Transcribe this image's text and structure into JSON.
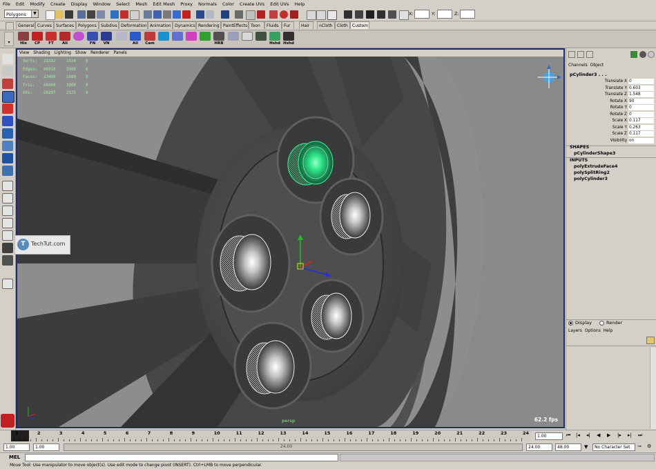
{
  "menubar": [
    "File",
    "Edit",
    "Modify",
    "Create",
    "Display",
    "Window",
    "Select",
    "Mesh",
    "Edit Mesh",
    "Proxy",
    "Normals",
    "Color",
    "Create UVs",
    "Edit UVs",
    "Help"
  ],
  "statusline": {
    "mode": "Polygons",
    "x_label": "X:",
    "y_label": "Y:",
    "z_label": "Z:"
  },
  "shelf_tabs": [
    "General",
    "Curves",
    "Surfaces",
    "Polygons",
    "Subdivs",
    "Deformation",
    "Animation",
    "Dynamics",
    "Rendering",
    "PaintEffects",
    "Toon",
    "Fluids",
    "Fur",
    "Hair",
    "nCloth",
    "Cloth",
    "Custom"
  ],
  "active_shelf_tab": "Custom",
  "shelf_buttons": [
    "His",
    "CP",
    "FT",
    "All",
    "",
    "FN",
    "VN",
    "",
    "",
    "All",
    "Cam",
    "",
    "",
    "",
    "",
    "HRB",
    "",
    "",
    "",
    "Hshd"
  ],
  "viewport": {
    "menu": [
      "View",
      "Shading",
      "Lighting",
      "Show",
      "Renderer",
      "Panels"
    ],
    "hud": [
      {
        "label": "Verts:",
        "total": "23332",
        "sel": "1510",
        "comp": "0"
      },
      {
        "label": "Edges:",
        "total": "46810",
        "sel": "3300",
        "comp": "0"
      },
      {
        "label": "Faces:",
        "total": "23480",
        "sel": "1800",
        "comp": "0"
      },
      {
        "label": "Tris:",
        "total": "46660",
        "sel": "3000",
        "comp": "0"
      },
      {
        "label": "UVs:",
        "total": "26297",
        "sel": "2135",
        "comp": "0"
      }
    ],
    "fps": "62.2 fps",
    "camera": "persp"
  },
  "watermark": {
    "brand": "TechTut",
    "suffix": ".com"
  },
  "channel_box": {
    "menu": [
      "Channels",
      "Object"
    ],
    "object": "pCylinder3 . . .",
    "attributes": [
      {
        "name": "Translate X",
        "value": "0"
      },
      {
        "name": "Translate Y",
        "value": "0.603"
      },
      {
        "name": "Translate Z",
        "value": "1.548"
      },
      {
        "name": "Rotate X",
        "value": "90"
      },
      {
        "name": "Rotate Y",
        "value": "0"
      },
      {
        "name": "Rotate Z",
        "value": "0"
      },
      {
        "name": "Scale X",
        "value": "0.117"
      },
      {
        "name": "Scale Y",
        "value": "0.263"
      },
      {
        "name": "Scale Z",
        "value": "0.117"
      },
      {
        "name": "Visibility",
        "value": "on"
      }
    ],
    "shapes_header": "SHAPES",
    "shape": "pCylinderShape3",
    "inputs_header": "INPUTS",
    "inputs": [
      "polyExtrudeFace4",
      "polySplitRing2",
      "polyCylinder3"
    ]
  },
  "layer_editor": {
    "display": "Display",
    "render": "Render",
    "menu": [
      "Layers",
      "Options",
      "Help"
    ]
  },
  "time_slider": {
    "ticks": [
      "1",
      "2",
      "3",
      "4",
      "5",
      "6",
      "7",
      "8",
      "9",
      "10",
      "11",
      "12",
      "13",
      "14",
      "15",
      "16",
      "17",
      "18",
      "19",
      "20",
      "21",
      "22",
      "23",
      "24"
    ],
    "current": "1.00"
  },
  "range": {
    "start": "1.00",
    "inner_start": "1.00",
    "inner_end": "24.00",
    "end": "48.00",
    "range_label": "24.00",
    "slider_value": "24.00",
    "char_set": "No Character Set"
  },
  "mel": {
    "label": "MEL"
  },
  "help_line": "Move Tool: Use manipulator to move object(s). Use edit mode to change pivot (INSERT). Ctrl+LMB to move perpendicular.",
  "colors": {
    "viewport_border": "#1c2a6e",
    "selection": "#2ee68a",
    "hud_text": "#9ed49e"
  }
}
